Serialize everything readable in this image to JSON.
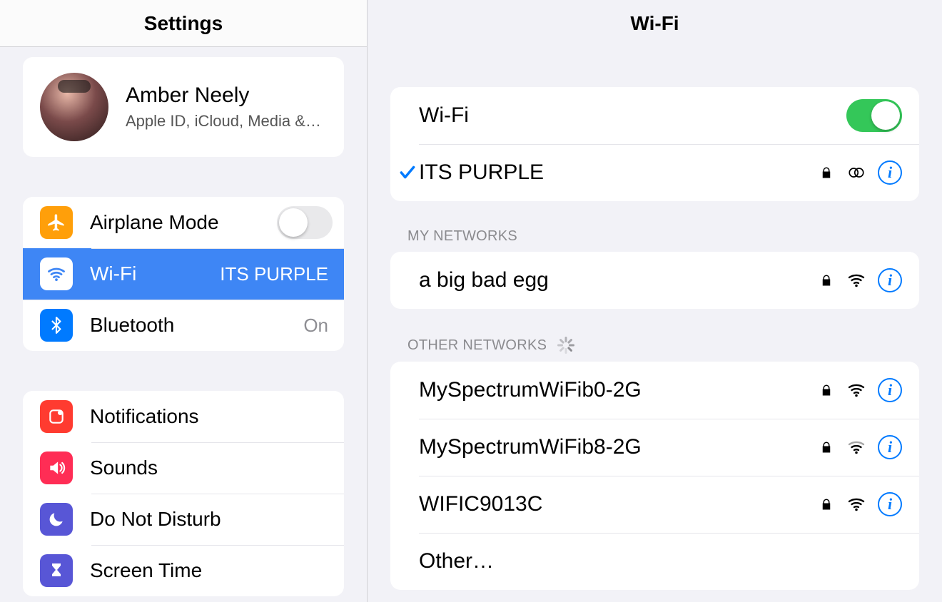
{
  "sidebar": {
    "title": "Settings",
    "apple_id": {
      "name": "Amber Neely",
      "subtitle": "Apple ID, iCloud, Media &…"
    },
    "group1": {
      "airplane": {
        "label": "Airplane Mode",
        "on": false
      },
      "wifi": {
        "label": "Wi-Fi",
        "value": "ITS PURPLE",
        "selected": true
      },
      "bluetooth": {
        "label": "Bluetooth",
        "value": "On"
      }
    },
    "group2": {
      "notifications": {
        "label": "Notifications"
      },
      "sounds": {
        "label": "Sounds"
      },
      "dnd": {
        "label": "Do Not Disturb"
      },
      "screentime": {
        "label": "Screen Time"
      }
    }
  },
  "main": {
    "title": "Wi-Fi",
    "toggle": {
      "label": "Wi-Fi",
      "on": true
    },
    "connected": {
      "name": "ITS PURPLE",
      "secured": true,
      "hotspot": true
    },
    "my_networks_header": "MY NETWORKS",
    "my_networks": [
      {
        "name": "a big bad egg",
        "secured": true
      }
    ],
    "other_header": "OTHER NETWORKS",
    "other_networks": [
      {
        "name": "MySpectrumWiFib0-2G",
        "secured": true
      },
      {
        "name": "MySpectrumWiFib8-2G",
        "secured": true
      },
      {
        "name": "WIFIC9013C",
        "secured": true
      }
    ],
    "other_label": "Other…"
  },
  "colors": {
    "accent": "#007aff",
    "selected": "#3e86f5",
    "green": "#34c759"
  }
}
